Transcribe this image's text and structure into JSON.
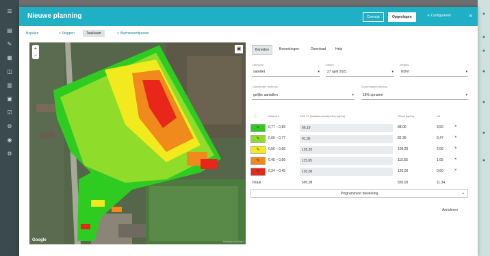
{
  "header": {
    "title": "Nieuwe planning",
    "concept_label": "Concept",
    "saved_label": "Opgeslagen",
    "config_label": "Configureren",
    "close_label": "×"
  },
  "steps": [
    {
      "label": "Bepalen"
    },
    {
      "label": "> Stappen"
    },
    {
      "label": "Taakkaart"
    },
    {
      "label": "> Wachtwoordpasset"
    }
  ],
  "map": {
    "zoom_in": "+",
    "zoom_out": "−",
    "fullscreen_icon": "▣",
    "google_label": "Google",
    "attribution": "Kaartgegevens ©2021"
  },
  "panel": {
    "tabs": [
      "Bereiden",
      "Bewerkingen",
      "Download",
      "Help"
    ],
    "fields": [
      {
        "label": "Categorie",
        "value": "satelliet"
      },
      {
        "label": "Datum",
        "value": "27 april 2021"
      },
      {
        "label": "Weging",
        "value": "NDVI"
      },
      {
        "label": "Classificatie methode",
        "value": "gelijke aantallen"
      },
      {
        "label": "Doseringsberekening",
        "value": "18% opname"
      }
    ],
    "grid_headers": [
      "Waarden",
      "KAS 27 (Kalkammonsalpeter) (kg/ha)",
      "Totaal (kg/ha)",
      "Ha"
    ],
    "rows": [
      {
        "range": "0,77 – 0,89",
        "dose": "66,19",
        "total": "88,00",
        "ha": "3,50",
        "color": "#2ecc21"
      },
      {
        "range": "0,66 – 0,77",
        "dose": "91,36",
        "total": "82,36",
        "ha": "3,47",
        "color": "#8fdc2a"
      },
      {
        "range": "0,56 – 0,66",
        "dose": "105,20",
        "total": "106,20",
        "ha": "2,06",
        "color": "#f2ea1c"
      },
      {
        "range": "0,45 – 0,56",
        "dose": "115,65",
        "total": "115,65",
        "ha": "1,65",
        "color": "#f08a1d"
      },
      {
        "range": "0,34 – 0,45",
        "dose": "120,00",
        "total": "120,00",
        "ha": "0,60",
        "color": "#e8261a"
      }
    ],
    "totals": {
      "label": "Totaal",
      "dose": "590,08",
      "total": "550,00",
      "ha": "11,34"
    },
    "program_label": "Programmeer bewerking",
    "plus_icon": "+",
    "advanced_label": "Annuleren",
    "delete_icon": "×",
    "edit_icon": "✎"
  },
  "colors": {
    "header": "#1fb0c6",
    "sidebar": "#3b4a4e",
    "zone_green": "#2ecc21",
    "zone_lightgreen": "#8fdc2a",
    "zone_yellow": "#f2ea1c",
    "zone_orange": "#f08a1d",
    "zone_red": "#e8261a"
  }
}
